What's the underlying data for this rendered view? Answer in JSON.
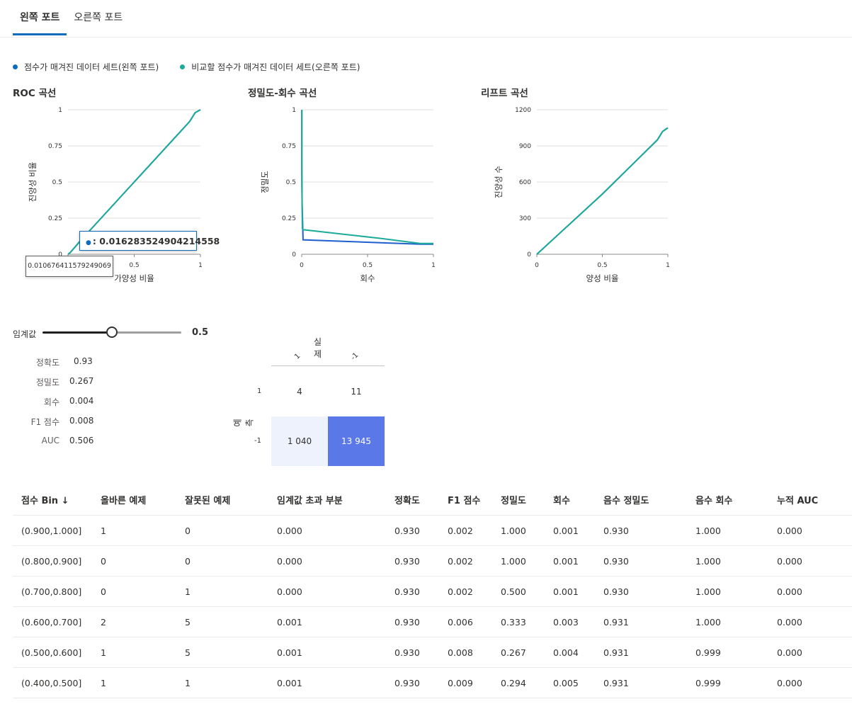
{
  "tabs": [
    {
      "label": "왼쪽 포트",
      "active": true
    },
    {
      "label": "오른쪽 포트",
      "active": false
    }
  ],
  "legend": [
    {
      "label": "점수가 매겨진 데이터 세트(왼쪽 포트)",
      "color": "#0f6cbd"
    },
    {
      "label": "비교할 점수가 매겨진 데이터 세트(오른쪽 포트)",
      "color": "#1cab98"
    }
  ],
  "colors": {
    "left": "#1f5fd0",
    "right": "#1cab98",
    "accent": "#0f6cbd"
  },
  "chart_data": [
    {
      "type": "line",
      "title": "ROC 곡선",
      "xlabel": "가양성 비율",
      "ylabel": "진양성 비율",
      "xlim": [
        0,
        1
      ],
      "ylim": [
        0,
        1
      ],
      "xticks": [
        "0",
        "0.5",
        "1"
      ],
      "yticks": [
        "0",
        "0.25",
        "0.5",
        "0.75",
        "1"
      ],
      "series": [
        {
          "color": "#1f5fd0",
          "x": [
            0,
            0.016,
            0.1,
            0.5,
            0.92,
            0.96,
            1
          ],
          "y": [
            0,
            0.011,
            0.1,
            0.5,
            0.92,
            0.98,
            1
          ]
        },
        {
          "color": "#1cab98",
          "x": [
            0,
            0.016,
            0.1,
            0.5,
            0.92,
            0.96,
            1
          ],
          "y": [
            0,
            0.011,
            0.1,
            0.5,
            0.92,
            0.98,
            1
          ]
        }
      ],
      "tooltip": {
        "value": ": 0.016283524904214558",
        "axis_value": "0.010676411579249069"
      }
    },
    {
      "type": "line",
      "title": "정밀도-회수 곡선",
      "xlabel": "회수",
      "ylabel": "정밀도",
      "xlim": [
        0,
        1
      ],
      "ylim": [
        0,
        1
      ],
      "xticks": [
        "0",
        "0.5",
        "1"
      ],
      "yticks": [
        "0",
        "0.25",
        "0.5",
        "0.75",
        "1"
      ],
      "series": [
        {
          "color": "#1f5fd0",
          "x": [
            0.001,
            0.001,
            0.003,
            0.005,
            0.01,
            0.3,
            0.6,
            0.9,
            1
          ],
          "y": [
            1,
            0.5,
            0.333,
            0.294,
            0.1,
            0.09,
            0.08,
            0.07,
            0.07
          ]
        },
        {
          "color": "#1cab98",
          "x": [
            0.001,
            0.001,
            0.003,
            0.005,
            0.01,
            0.3,
            0.6,
            0.9,
            1
          ],
          "y": [
            1,
            0.66,
            0.35,
            0.18,
            0.17,
            0.14,
            0.11,
            0.075,
            0.075
          ]
        }
      ]
    },
    {
      "type": "line",
      "title": "리프트 곡선",
      "xlabel": "양성 비율",
      "ylabel": "진양성 수",
      "xlim": [
        0,
        1
      ],
      "ylim": [
        0,
        1200
      ],
      "xticks": [
        "0",
        "0.5",
        "1"
      ],
      "yticks": [
        "0",
        "300",
        "600",
        "900",
        "1200"
      ],
      "series": [
        {
          "color": "#1f5fd0",
          "x": [
            0,
            0.5,
            0.92,
            0.96,
            1
          ],
          "y": [
            0,
            500,
            950,
            1020,
            1050
          ]
        },
        {
          "color": "#1cab98",
          "x": [
            0,
            0.5,
            0.92,
            0.96,
            1
          ],
          "y": [
            0,
            500,
            950,
            1020,
            1050
          ]
        }
      ]
    },
    {
      "type": "heatmap",
      "title": "실제",
      "ylabel": "예측",
      "columns": [
        "1",
        "-1"
      ],
      "rows": [
        "1",
        "-1"
      ],
      "values": [
        [
          "4",
          "11"
        ],
        [
          "1 040",
          "13 945"
        ]
      ],
      "cell_colors": [
        [
          "#ffffff",
          "#ffffff"
        ],
        [
          "#eef2fc",
          "#5b78e8"
        ]
      ],
      "text_colors": [
        [
          "#323130",
          "#323130"
        ],
        [
          "#323130",
          "#ffffff"
        ]
      ]
    }
  ],
  "threshold": {
    "label": "임계값",
    "value": "0.5",
    "fraction": 0.5
  },
  "metrics": [
    {
      "label": "정확도",
      "value": "0.93"
    },
    {
      "label": "정밀도",
      "value": "0.267"
    },
    {
      "label": "회수",
      "value": "0.004"
    },
    {
      "label": "F1 점수",
      "value": "0.008"
    },
    {
      "label": "AUC",
      "value": "0.506"
    }
  ],
  "table": {
    "headers": [
      "점수 Bin ↓",
      "올바른 예제",
      "잘못된 예제",
      "임계값 초과 부분",
      "정확도",
      "F1 점수",
      "정밀도",
      "회수",
      "음수 정밀도",
      "음수 회수",
      "누적 AUC"
    ],
    "rows": [
      [
        "(0.900,1.000]",
        "1",
        "0",
        "0.000",
        "0.930",
        "0.002",
        "1.000",
        "0.001",
        "0.930",
        "1.000",
        "0.000"
      ],
      [
        "(0.800,0.900]",
        "0",
        "0",
        "0.000",
        "0.930",
        "0.002",
        "1.000",
        "0.001",
        "0.930",
        "1.000",
        "0.000"
      ],
      [
        "(0.700,0.800]",
        "0",
        "1",
        "0.000",
        "0.930",
        "0.002",
        "0.500",
        "0.001",
        "0.930",
        "1.000",
        "0.000"
      ],
      [
        "(0.600,0.700]",
        "2",
        "5",
        "0.001",
        "0.930",
        "0.006",
        "0.333",
        "0.003",
        "0.931",
        "1.000",
        "0.000"
      ],
      [
        "(0.500,0.600]",
        "1",
        "5",
        "0.001",
        "0.930",
        "0.008",
        "0.267",
        "0.004",
        "0.931",
        "0.999",
        "0.000"
      ],
      [
        "(0.400,0.500]",
        "1",
        "1",
        "0.001",
        "0.930",
        "0.009",
        "0.294",
        "0.005",
        "0.931",
        "0.999",
        "0.000"
      ]
    ]
  }
}
